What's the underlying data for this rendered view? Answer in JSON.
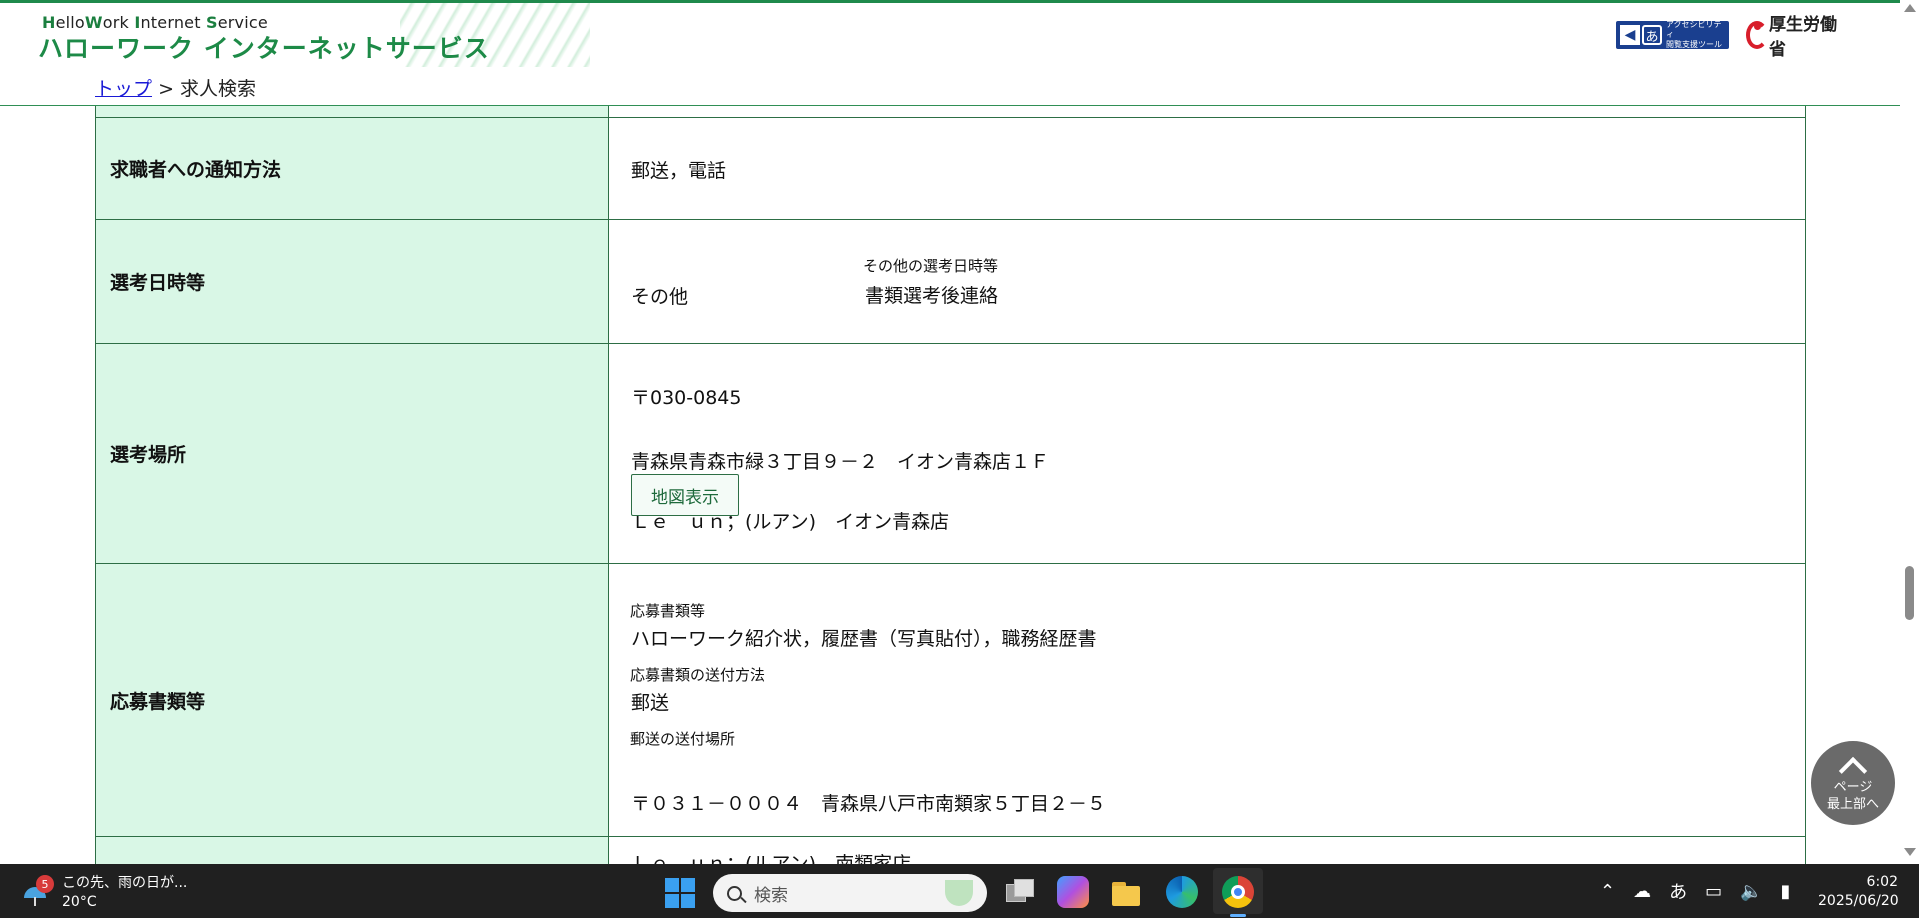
{
  "header": {
    "brand_en_parts": [
      "H",
      "ello",
      "W",
      "ork ",
      "I",
      "nternet ",
      "S",
      "ervice"
    ],
    "brand_jp": "ハローワーク インターネットサービス",
    "accessibility_label_line1": "アクセシビリティ",
    "accessibility_label_line2": "閲覧支援ツール",
    "accessibility_icon_glyph": "あ",
    "ministry": "厚生労働省"
  },
  "breadcrumb": {
    "top_link": "トップ",
    "separator": ">",
    "current": "求人検索"
  },
  "rows": {
    "notify": {
      "label": "求職者への通知方法",
      "value": "郵送，電話"
    },
    "selection_date": {
      "label": "選考日時等",
      "value": "その他",
      "other_label": "その他の選考日時等",
      "other_value": "書類選考後連絡"
    },
    "selection_place": {
      "label": "選考場所",
      "postal": "〒030-0845",
      "address_line1": "青森県青森市緑３丁目９－２　イオン青森店１Ｆ",
      "address_line2": "Ｌｅ　ｕｎ；(ルアン)　イオン青森店",
      "map_button": "地図表示"
    },
    "documents": {
      "label": "応募書類等",
      "docs_label": "応募書類等",
      "docs_value": "ハローワーク紹介状，履歴書（写真貼付），職務経歴書",
      "send_method_label": "応募書類の送付方法",
      "send_method_value": "郵送",
      "send_place_label": "郵送の送付場所",
      "send_place_line1": "〒０３１－０００４　青森県八戸市南類家５丁目２－５",
      "send_place_line2": "Ｌｅ　ｕｎ；(ルアン)　南類家店"
    }
  },
  "page_top_button": {
    "line1": "ページ",
    "line2": "最上部へ"
  },
  "taskbar": {
    "weather_badge": "5",
    "weather_text": "この先、雨の日が...",
    "weather_temp": "20°C",
    "search_placeholder": "検索",
    "ime": "あ",
    "time": "6:02",
    "date": "2025/06/20"
  },
  "colors": {
    "brand_green": "#1d8a47",
    "header_cell_bg": "#d9f7e6",
    "border": "#2d6e45",
    "link": "#1a1ad6",
    "taskbar_bg": "#202020"
  }
}
